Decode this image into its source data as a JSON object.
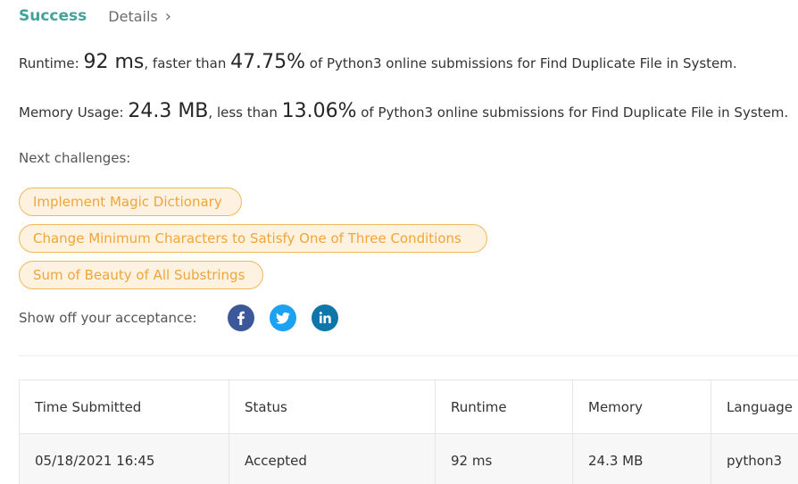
{
  "header": {
    "status": "Success",
    "details_label": "Details",
    "chevron": "›"
  },
  "runtime": {
    "label": "Runtime: ",
    "value": "92 ms",
    "connector": ", faster than ",
    "percent": "47.75%",
    "suffix": " of Python3 online submissions for Find Duplicate File in System."
  },
  "memory": {
    "label": "Memory Usage: ",
    "value": "24.3 MB",
    "connector": ", less than ",
    "percent": "13.06%",
    "suffix": " of Python3 online submissions for Find Duplicate File in System."
  },
  "next_challenges": {
    "label": "Next challenges:",
    "items": [
      "Implement Magic Dictionary",
      "Change Minimum Characters to Satisfy One of Three Conditions",
      "Sum of Beauty of All Substrings"
    ]
  },
  "share": {
    "label": "Show off your acceptance:",
    "icons": [
      "facebook-icon",
      "twitter-icon",
      "linkedin-icon"
    ]
  },
  "table": {
    "headers": [
      "Time Submitted",
      "Status",
      "Runtime",
      "Memory",
      "Language"
    ],
    "rows": [
      [
        "05/18/2021 16:45",
        "Accepted",
        "92 ms",
        "24.3 MB",
        "python3"
      ]
    ]
  },
  "colors": {
    "success": "#43a29a",
    "challenge_text": "#f0a53a",
    "challenge_border": "#f0b85a",
    "challenge_bg": "#fdf2df",
    "facebook": "#3b5998",
    "twitter": "#1da1f2",
    "linkedin": "#0e76a8"
  }
}
